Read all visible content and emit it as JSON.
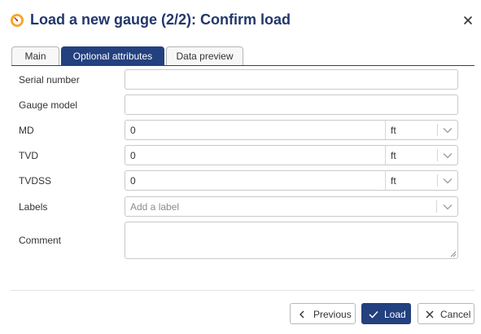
{
  "dialog": {
    "title": "Load a new gauge (2/2): Confirm load",
    "icons": {
      "title": "gauge-icon",
      "close": "close-icon"
    },
    "accent_color": "#23407f",
    "title_color": "#23376b"
  },
  "tabs": [
    {
      "label": "Main",
      "active": false
    },
    {
      "label": "Optional attributes",
      "active": true
    },
    {
      "label": "Data preview",
      "active": false
    }
  ],
  "form": {
    "serial_number": {
      "label": "Serial number",
      "value": ""
    },
    "gauge_model": {
      "label": "Gauge model",
      "value": ""
    },
    "md": {
      "label": "MD",
      "value": "0",
      "unit": "ft"
    },
    "tvd": {
      "label": "TVD",
      "value": "0",
      "unit": "ft"
    },
    "tvdss": {
      "label": "TVDSS",
      "value": "0",
      "unit": "ft"
    },
    "labels": {
      "label": "Labels",
      "placeholder": "Add a label"
    },
    "comment": {
      "label": "Comment",
      "value": ""
    }
  },
  "footer": {
    "previous_label": "Previous",
    "load_label": "Load",
    "cancel_label": "Cancel",
    "icons": {
      "previous": "chevron-left-icon",
      "load": "check-icon",
      "cancel": "x-icon"
    }
  }
}
